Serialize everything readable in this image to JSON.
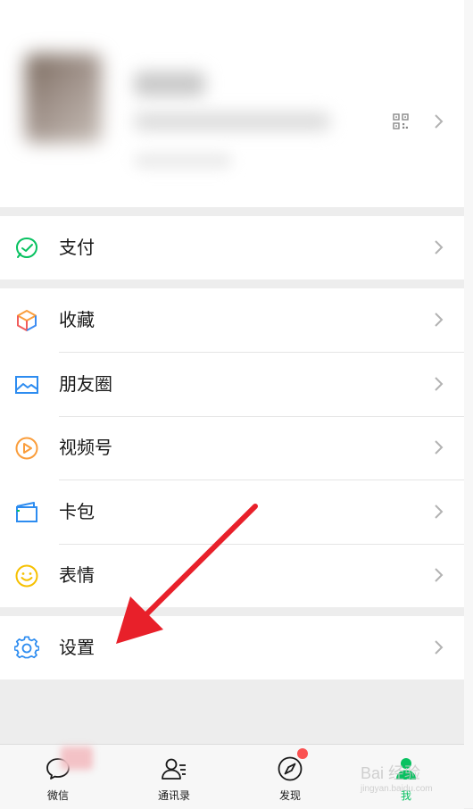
{
  "menu": {
    "pay": {
      "label": "支付",
      "icon": "pay-icon"
    },
    "favorites": {
      "label": "收藏",
      "icon": "favorites-cube-icon"
    },
    "moments": {
      "label": "朋友圈",
      "icon": "moments-image-icon"
    },
    "channels": {
      "label": "视频号",
      "icon": "channels-play-icon"
    },
    "cards": {
      "label": "卡包",
      "icon": "card-wallet-icon"
    },
    "stickers": {
      "label": "表情",
      "icon": "smiley-icon"
    },
    "settings": {
      "label": "设置",
      "icon": "gear-icon"
    }
  },
  "tabbar": {
    "tabs": [
      {
        "label": "微信",
        "icon": "chat-bubble-icon",
        "active": false
      },
      {
        "label": "通讯录",
        "icon": "contacts-icon",
        "active": false
      },
      {
        "label": "发现",
        "icon": "compass-icon",
        "active": false,
        "badge": "red-dot"
      },
      {
        "label": "我",
        "icon": "me-icon",
        "active": true
      }
    ]
  },
  "watermark": {
    "text": "Bai 经验",
    "subtext": "jingyan.baidu.com"
  },
  "colors": {
    "accent": "#07c160",
    "badge": "#fa5151",
    "arrow": "#e8202a",
    "background": "#ededed"
  }
}
